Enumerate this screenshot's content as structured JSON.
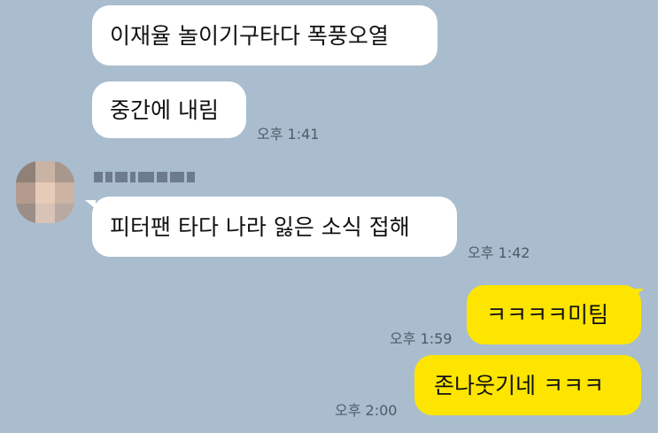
{
  "messages": [
    {
      "side": "left",
      "text": "이재율 놀이기구타다 폭풍오열",
      "time": ""
    },
    {
      "side": "left",
      "text": "중간에 내림",
      "time": "오후 1:41"
    },
    {
      "side": "left",
      "text": "피터팬 타다 나라 잃은 소식 접해",
      "time": "오후 1:42"
    },
    {
      "side": "right",
      "text": "ㅋㅋㅋㅋ미팀",
      "time": "오후 1:59"
    },
    {
      "side": "right",
      "text": "존나웃기네 ㅋㅋㅋ",
      "time": "오후 2:00"
    }
  ],
  "colors": {
    "background": "#a9bdcf",
    "incoming_bubble": "#ffffff",
    "outgoing_bubble": "#fee500",
    "timestamp": "#4e5b67"
  },
  "icons": {
    "avatar": "blurred-profile-avatar"
  }
}
